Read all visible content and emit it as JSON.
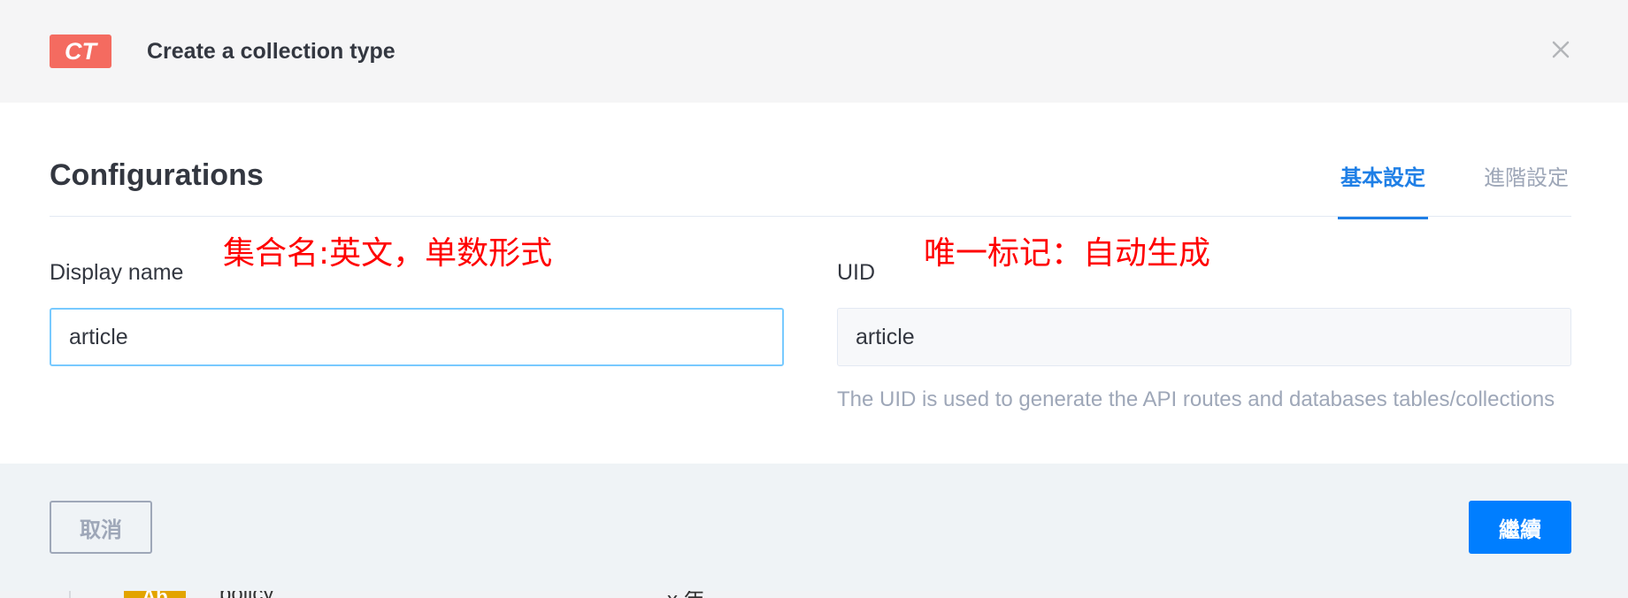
{
  "background_list": {
    "badge": "Ab",
    "name": "policy",
    "count": "x 年"
  },
  "modal": {
    "badge": "CT",
    "title": "Create a collection type",
    "close_icon": "close-icon",
    "section_title": "Configurations",
    "tabs": [
      {
        "label": "基本設定",
        "active": true
      },
      {
        "label": "進階設定",
        "active": false
      }
    ],
    "display_name": {
      "label": "Display name",
      "value": "article",
      "annotation": "集合名:英文，单数形式"
    },
    "uid": {
      "label": "UID",
      "value": "article",
      "annotation": "唯一标记：自动生成",
      "hint": "The UID is used to generate the API routes and databases tables/collections"
    },
    "footer": {
      "cancel_label": "取消",
      "continue_label": "繼續"
    }
  },
  "colors": {
    "badge": "#f46b60",
    "primary": "#007eff",
    "tab_active": "#1f7fe6",
    "input_focus_border": "#78caff",
    "annotation": "#ff0000"
  }
}
